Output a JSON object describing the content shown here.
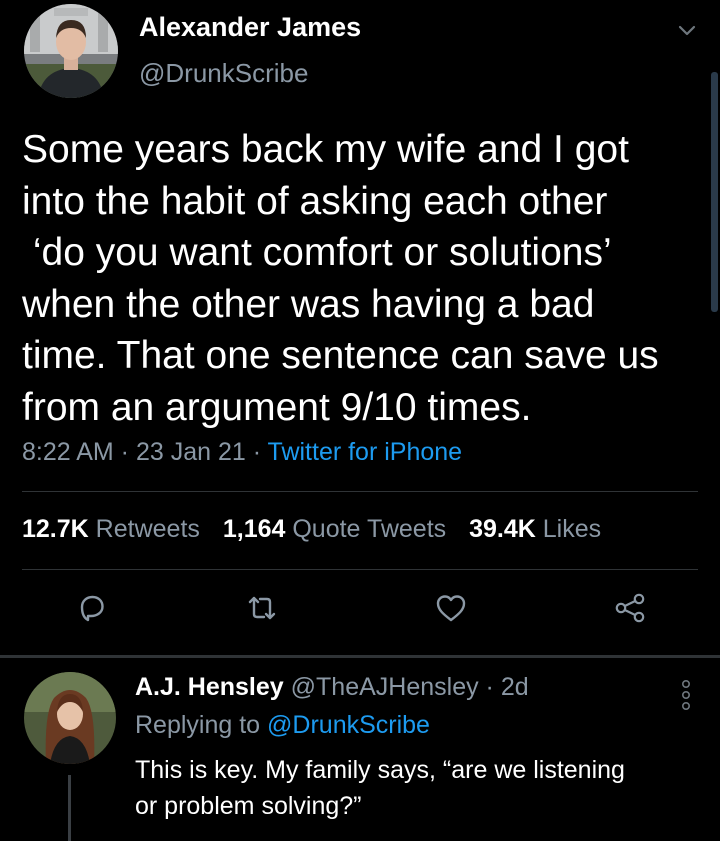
{
  "tweet": {
    "author_name": "Alexander James",
    "author_handle": "@DrunkScribe",
    "text_lines": [
      "Some years back my wife and I got",
      "into the habit of asking each other",
      " ‘do you want comfort or solutions’",
      "when the other was having a bad",
      "time. That one sentence can save us",
      "from an argument 9/10 times."
    ],
    "time": "8:22 AM",
    "date": "23 Jan 21",
    "separator": " · ",
    "source": "Twitter for iPhone",
    "stats": {
      "retweets_count": "12.7K",
      "retweets_label": "Retweets",
      "quotes_count": "1,164",
      "quotes_label": "Quote Tweets",
      "likes_count": "39.4K",
      "likes_label": "Likes"
    },
    "actions": [
      "reply-icon",
      "retweet-icon",
      "like-icon",
      "share-icon"
    ]
  },
  "reply": {
    "name": "A.J. Hensley",
    "handle": "@TheAJHensley",
    "age": "2d",
    "separator": " · ",
    "replying_label": "Replying to",
    "replying_to": "@DrunkScribe",
    "text_lines": [
      "This is key. My family says, “are we listening",
      "or problem solving?”"
    ]
  },
  "colors": {
    "background": "#000000",
    "text": "#ffffff",
    "secondary_text": "#8b98a5",
    "link": "#1d9bf0",
    "divider": "#2f3336"
  }
}
